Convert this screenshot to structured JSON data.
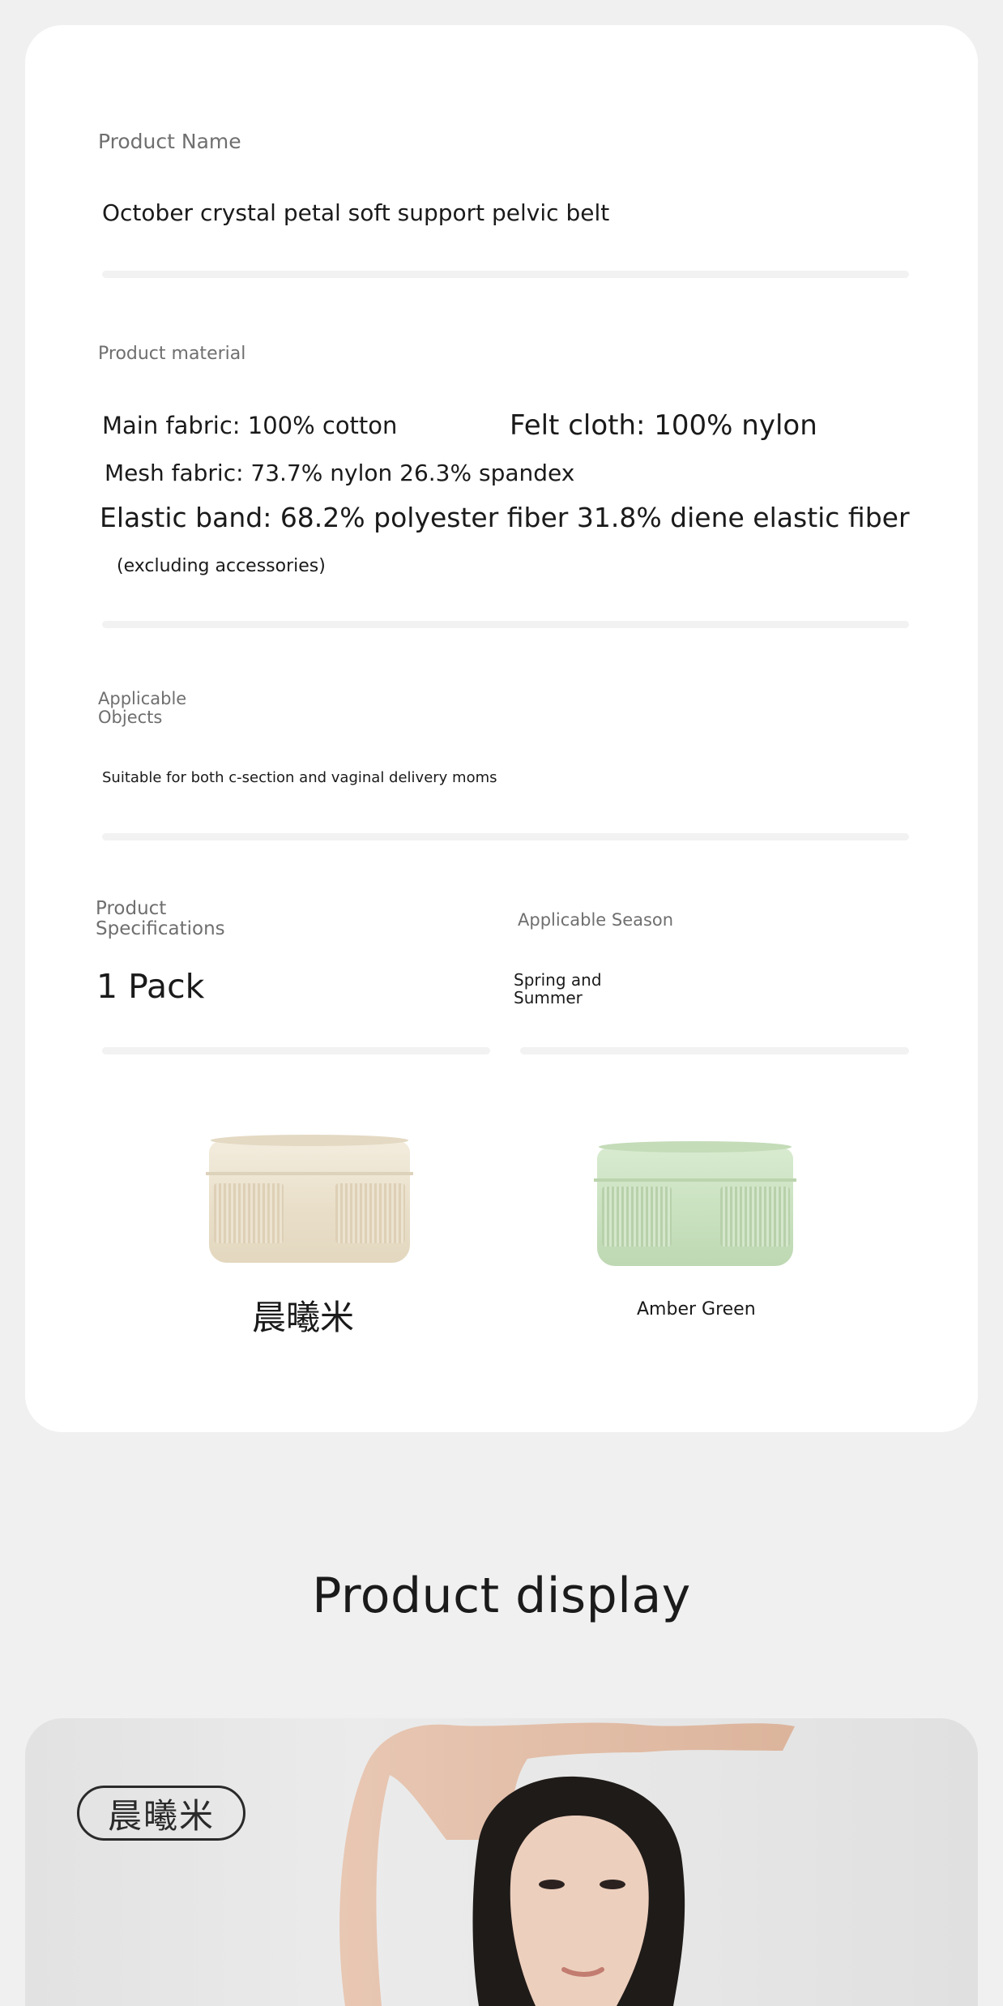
{
  "spec_card": {
    "product_name": {
      "label": "Product Name",
      "value": "October crystal petal soft support pelvic belt"
    },
    "material": {
      "label": "Product material",
      "main_fabric": "Main fabric: 100% cotton",
      "felt_cloth": "Felt cloth: 100% nylon",
      "mesh_fabric": "Mesh fabric: 73.7% nylon 26.3% spandex",
      "elastic_band": "Elastic band: 68.2% polyester fiber 31.8% diene elastic fiber",
      "note": "(excluding accessories)"
    },
    "applicable_objects": {
      "label": "Applicable Objects",
      "value": "Suitable for both c-section and vaginal delivery moms"
    },
    "specifications": {
      "label": "Product Specifications",
      "value": "1 Pack"
    },
    "season": {
      "label": "Applicable Season",
      "value": "Spring and Summer"
    },
    "colors": [
      {
        "name": "晨曦米",
        "swatch": "#efe6d4"
      },
      {
        "name": "Amber Green",
        "swatch": "#cfe5c6"
      }
    ]
  },
  "product_display": {
    "title": "Product display",
    "badge": "晨曦米"
  },
  "colors": {
    "page_bg": "#f0f0f0",
    "card_bg": "#ffffff",
    "divider": "#f2f2f2",
    "label_text": "#6f6f6f"
  }
}
